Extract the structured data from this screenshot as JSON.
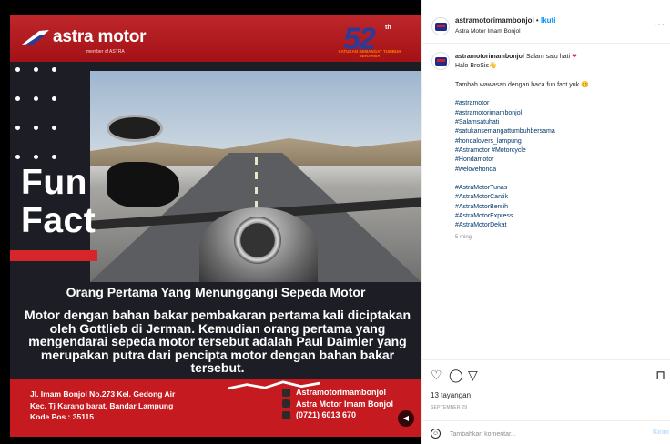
{
  "media": {
    "brand_name": "astra motor",
    "brand_sub": "member of ASTRA",
    "anniversary_number": "52",
    "anniversary_suffix": "th",
    "anniversary_tagline": "SATUKAN SEMANGAT TUMBUH BERSAMA",
    "fun_line1": "Fun",
    "fun_line2": "Fact",
    "headline": "Orang Pertama Yang Menunggangi Sepeda Motor",
    "body": "Motor dengan bahan bakar pembakaran pertama kali diciptakan oleh Gottlieb di Jerman. Kemudian orang pertama yang mengendarai sepeda motor tersebut adalah Paul Daimler yang merupakan putra dari pencipta motor dengan bahan bakar tersebut.",
    "address_lines": [
      "Jl. Imam Bonjol No.273 Kel. Gedong Air",
      "Kec. Tj Karang barat, Bandar Lampung",
      "Kode Pos : 35115"
    ],
    "contacts": [
      {
        "icon": "instagram-icon",
        "text": "Astramotorimambonjol"
      },
      {
        "icon": "facebook-icon",
        "text": "Astra Motor Imam Bonjol"
      },
      {
        "icon": "phone-icon",
        "text": "(0721) 6013 670"
      }
    ],
    "sound_icon": "speaker-muted-icon"
  },
  "panel": {
    "username": "astramotorimambonjol",
    "separator": "•",
    "follow_label": "Ikuti",
    "location": "Astra Motor Imam Bonjol",
    "more_label": "...",
    "caption": {
      "line1": "Salam satu hati",
      "line2": "Halo BroSis👋",
      "line3": "Tambah wawasan dengan baca fun fact yuk 😊",
      "tags_a": [
        "#astramotor",
        "#astramotorimambonjol",
        "#Salamsatuhati",
        "#satukansemangattumbuhbersama",
        "#hondalovers_lampung",
        "#Astramotor #Motorcycle",
        "#Hondamotor",
        "#welovehonda"
      ],
      "tags_b": [
        "#AstraMotorTunas",
        "#AstraMotorCantik",
        "#AstraMotorBersih",
        "#AstraMotorExpress",
        "#AstraMotorDekat"
      ],
      "time_ago": "5 ming"
    },
    "actions": {
      "like_icon": "heart-icon",
      "comment_icon": "comment-icon",
      "share_icon": "send-icon",
      "save_icon": "bookmark-icon"
    },
    "views": "13 tayangan",
    "date": "SEPTEMBER 29",
    "comment_placeholder": "Tambahkan komentar...",
    "post_label": "Kirim"
  },
  "colors": {
    "brand_red": "#c51b20",
    "brand_blue": "#1f2b8a",
    "link_blue": "#0095f6",
    "hashtag_blue": "#00376b"
  }
}
